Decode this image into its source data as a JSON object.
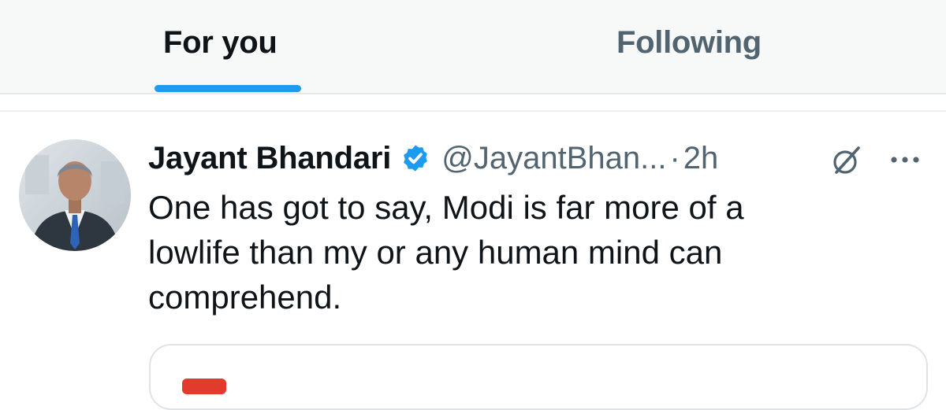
{
  "tabs": {
    "for_you": "For you",
    "following": "Following",
    "active": "For you"
  },
  "tweet": {
    "author": {
      "name": "Jayant Bhandari",
      "verified": true,
      "handle": "@JayantBhan..."
    },
    "separator": "·",
    "time": "2h",
    "text": "One has got to say, Modi is far more of a\nlowlife than my or any human mind can\ncomprehend."
  },
  "icons": {
    "verified": "verified-badge-icon",
    "grok": "grok-icon",
    "more": "more-options-icon"
  },
  "colors": {
    "accent": "#1d9bf0",
    "text_primary": "#0f1419",
    "text_secondary": "#536471",
    "tabbar_bg": "#f7f8f8",
    "quote_thumb": "#e23b2e"
  }
}
